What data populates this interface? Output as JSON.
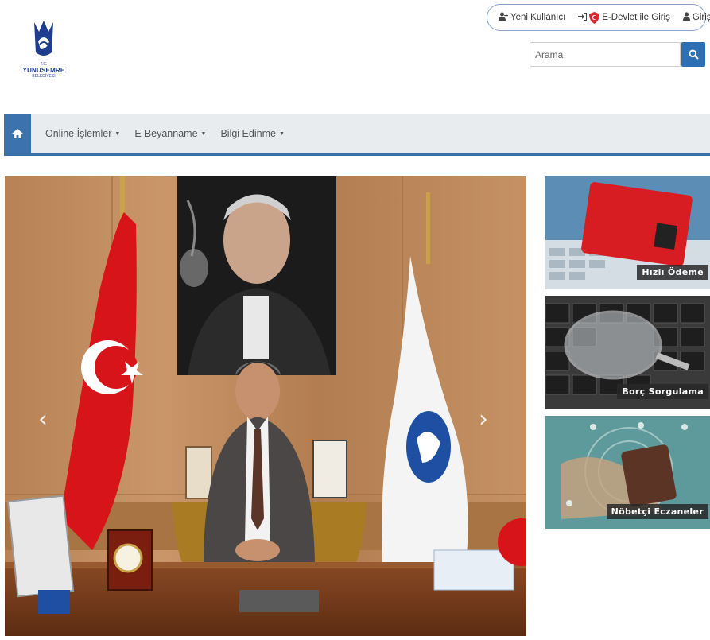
{
  "logo": {
    "tc": "T.C.",
    "name": "YUNUSEMRE",
    "sub": "BELEDİYESİ"
  },
  "toplinks": {
    "new_user": "Yeni Kullanıcı",
    "edevlet": "E-Devlet ile Giriş",
    "login": "Giriş"
  },
  "search": {
    "placeholder": "Arama"
  },
  "nav": {
    "items": [
      {
        "label": "Online İşlemler"
      },
      {
        "label": "E-Beyanname"
      },
      {
        "label": "Bilgi Edinme"
      }
    ]
  },
  "tiles": [
    {
      "label": "Hızlı Ödeme"
    },
    {
      "label": "Borç Sorgulama"
    },
    {
      "label": "Nöbetçi Eczaneler"
    }
  ],
  "colors": {
    "accent": "#3b6fa8",
    "nav_bg": "#e8ecef",
    "search_button": "#2d6fb4"
  }
}
